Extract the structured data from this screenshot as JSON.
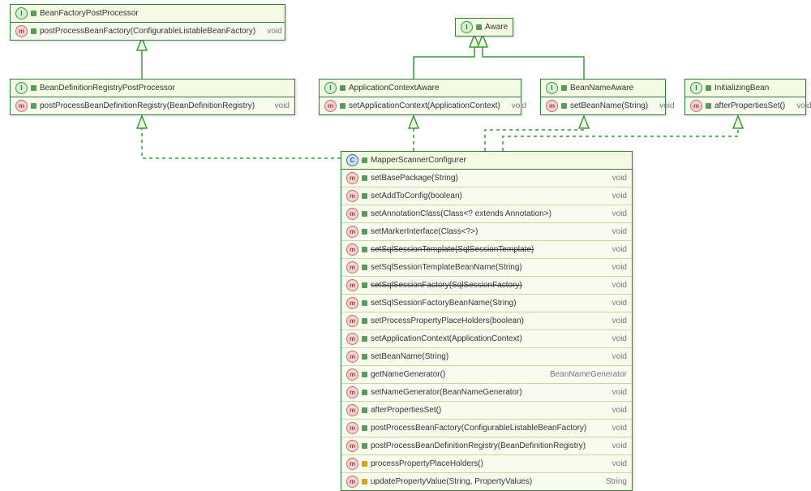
{
  "boxes": {
    "beanFactoryPost": {
      "title": "BeanFactoryPostProcessor",
      "method": "postProcessBeanFactory(ConfigurableListableBeanFactory)",
      "ret": "void",
      "type": "I"
    },
    "aware": {
      "title": "Aware",
      "type": "I"
    },
    "beanDefReg": {
      "title": "BeanDefinitionRegistryPostProcessor",
      "method": "postProcessBeanDefinitionRegistry(BeanDefinitionRegistry)",
      "ret": "void",
      "type": "I"
    },
    "appContextAware": {
      "title": "ApplicationContextAware",
      "method": "setApplicationContext(ApplicationContext)",
      "ret": "void",
      "type": "I"
    },
    "beanNameAware": {
      "title": "BeanNameAware",
      "method": "setBeanName(String)",
      "ret": "void",
      "type": "I"
    },
    "initBean": {
      "title": "InitializingBean",
      "method": "afterPropertiesSet()",
      "ret": "void",
      "type": "I"
    },
    "mapper": {
      "title": "MapperScannerConfigurer",
      "type": "C",
      "methods": [
        {
          "name": "setBasePackage(String)",
          "ret": "void",
          "strike": false,
          "abstract": true
        },
        {
          "name": "setAddToConfig(boolean)",
          "ret": "void",
          "strike": false,
          "abstract": true
        },
        {
          "name": "setAnnotationClass(Class<? extends Annotation>)",
          "ret": "void",
          "strike": false,
          "abstract": true
        },
        {
          "name": "setMarkerInterface(Class<?>)",
          "ret": "void",
          "strike": false,
          "abstract": true
        },
        {
          "name": "setSqlSessionTemplate(SqlSessionTemplate)",
          "ret": "void",
          "strike": true,
          "abstract": true
        },
        {
          "name": "setSqlSessionTemplateBeanName(String)",
          "ret": "void",
          "strike": false,
          "abstract": true
        },
        {
          "name": "setSqlSessionFactory(SqlSessionFactory)",
          "ret": "void",
          "strike": true,
          "abstract": true
        },
        {
          "name": "setSqlSessionFactoryBeanName(String)",
          "ret": "void",
          "strike": false,
          "abstract": true
        },
        {
          "name": "setProcessPropertyPlaceHolders(boolean)",
          "ret": "void",
          "strike": false,
          "abstract": true
        },
        {
          "name": "setApplicationContext(ApplicationContext)",
          "ret": "void",
          "strike": false,
          "abstract": true
        },
        {
          "name": "setBeanName(String)",
          "ret": "void",
          "strike": false,
          "abstract": true
        },
        {
          "name": "getNameGenerator()",
          "ret": "BeanNameGenerator",
          "strike": false,
          "abstract": true
        },
        {
          "name": "setNameGenerator(BeanNameGenerator)",
          "ret": "void",
          "strike": false,
          "abstract": true
        },
        {
          "name": "afterPropertiesSet()",
          "ret": "void",
          "strike": false,
          "abstract": true
        },
        {
          "name": "postProcessBeanFactory(ConfigurableListableBeanFactory)",
          "ret": "void",
          "strike": false,
          "abstract": true
        },
        {
          "name": "postProcessBeanDefinitionRegistry(BeanDefinitionRegistry)",
          "ret": "void",
          "strike": false,
          "abstract": true
        },
        {
          "name": "processPropertyPlaceHolders()",
          "ret": "void",
          "strike": false,
          "abstract": false
        },
        {
          "name": "updatePropertyValue(String, PropertyValues)",
          "ret": "String",
          "strike": false,
          "abstract": false
        }
      ]
    }
  },
  "chart_data": {
    "type": "uml_class_diagram",
    "classes": [
      {
        "name": "BeanFactoryPostProcessor",
        "kind": "interface"
      },
      {
        "name": "Aware",
        "kind": "interface"
      },
      {
        "name": "BeanDefinitionRegistryPostProcessor",
        "kind": "interface"
      },
      {
        "name": "ApplicationContextAware",
        "kind": "interface"
      },
      {
        "name": "BeanNameAware",
        "kind": "interface"
      },
      {
        "name": "InitializingBean",
        "kind": "interface"
      },
      {
        "name": "MapperScannerConfigurer",
        "kind": "class"
      }
    ],
    "relations": [
      {
        "from": "BeanDefinitionRegistryPostProcessor",
        "to": "BeanFactoryPostProcessor",
        "type": "extends"
      },
      {
        "from": "ApplicationContextAware",
        "to": "Aware",
        "type": "extends"
      },
      {
        "from": "BeanNameAware",
        "to": "Aware",
        "type": "extends"
      },
      {
        "from": "MapperScannerConfigurer",
        "to": "BeanDefinitionRegistryPostProcessor",
        "type": "implements"
      },
      {
        "from": "MapperScannerConfigurer",
        "to": "ApplicationContextAware",
        "type": "implements"
      },
      {
        "from": "MapperScannerConfigurer",
        "to": "BeanNameAware",
        "type": "implements"
      },
      {
        "from": "MapperScannerConfigurer",
        "to": "InitializingBean",
        "type": "implements"
      }
    ]
  }
}
